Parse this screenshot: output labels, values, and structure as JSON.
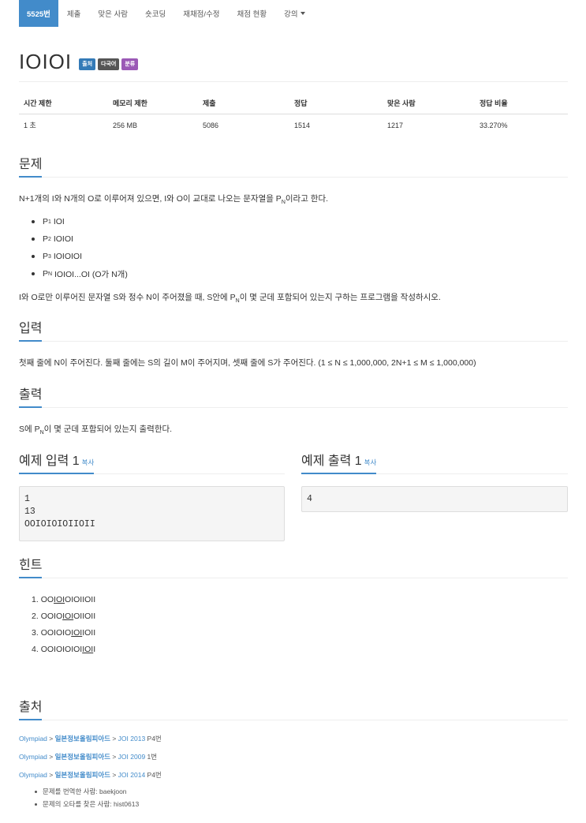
{
  "nav": {
    "tabs": [
      "5525번",
      "제출",
      "맞은 사람",
      "숏코딩",
      "재채점/수정",
      "채점 현황",
      "강의"
    ]
  },
  "problem": {
    "title": "IOIOI",
    "labels": [
      "출처",
      "다국어",
      "분류"
    ]
  },
  "info": {
    "headers": [
      "시간 제한",
      "메모리 제한",
      "제출",
      "정답",
      "맞은 사람",
      "정답 비율"
    ],
    "values": [
      "1 초",
      "256 MB",
      "5086",
      "1514",
      "1217",
      "33.270%"
    ]
  },
  "sections": {
    "problem": "문제",
    "input": "입력",
    "output": "출력",
    "sample_input": "예제 입력 1",
    "sample_output": "예제 출력 1",
    "copy": "복사",
    "hint": "힌트",
    "source": "출처"
  },
  "statement": {
    "line1_a": "N+1개의 I와 N개의 O로 이루어져 있으면, I와 O이 교대로 나오는 문자열을 P",
    "line1_sub": "N",
    "line1_b": "이라고 한다.",
    "items": [
      {
        "p": "P",
        "sub": "1",
        "text": "IOI"
      },
      {
        "p": "P",
        "sub": "2",
        "text": "IOIOI"
      },
      {
        "p": "P",
        "sub": "3",
        "text": "IOIOIOI"
      },
      {
        "p": "P",
        "sub": "N",
        "text": "IOIOI...OI (O가 N개)"
      }
    ],
    "line2_a": "I와 O로만 이루어진 문자열 S와 정수 N이 주어졌을 때, S안에 P",
    "line2_sub": "N",
    "line2_b": "이 몇 군데 포함되어 있는지 구하는 프로그램을 작성하시오."
  },
  "input_text": "첫째 줄에 N이 주어진다. 둘째 줄에는 S의 길이 M이 주어지며, 셋째 줄에 S가 주어진다. (1 ≤ N ≤ 1,000,000, 2N+1 ≤ M ≤ 1,000,000)",
  "output_text": {
    "a": "S에 P",
    "sub": "N",
    "b": "이 몇 군데 포함되어 있는지 출력한다."
  },
  "sample": {
    "input": "1\n13\nOOIOIOIOIIOII",
    "output": "4"
  },
  "hints": [
    {
      "n": "1.",
      "pre": "OO",
      "u": "IOI",
      "post": "OIOIIOII"
    },
    {
      "n": "2.",
      "pre": "OOIO",
      "u": "IOI",
      "post": "OIIOII"
    },
    {
      "n": "3.",
      "pre": "OOIOIO",
      "u": "IOI",
      "post": "IOII"
    },
    {
      "n": "4.",
      "pre": "OOIOIOIOI",
      "u": "IOI",
      "post": "I"
    }
  ],
  "sources": [
    {
      "a": "Olympiad",
      "sep1": " > ",
      "b": "일본정보올림피아드",
      "sep2": " > ",
      "c": "JOI 2013",
      "d": " P4번"
    },
    {
      "a": "Olympiad",
      "sep1": " > ",
      "b": "일본정보올림피아드",
      "sep2": " > ",
      "c": "JOI 2009",
      "d": " 1번"
    },
    {
      "a": "Olympiad",
      "sep1": " > ",
      "b": "일본정보올림피아드",
      "sep2": " > ",
      "c": "JOI 2014",
      "d": " P4번"
    }
  ],
  "credits": [
    {
      "label": "문제를 번역한 사람: ",
      "user": "baekjoon"
    },
    {
      "label": "문제의 오타를 찾은 사람: ",
      "user": "hist0613"
    }
  ],
  "colors": {
    "accent": "#428bca",
    "label_blue": "#337ab7",
    "label_gray": "#555555",
    "label_purple": "#9b59b6"
  }
}
